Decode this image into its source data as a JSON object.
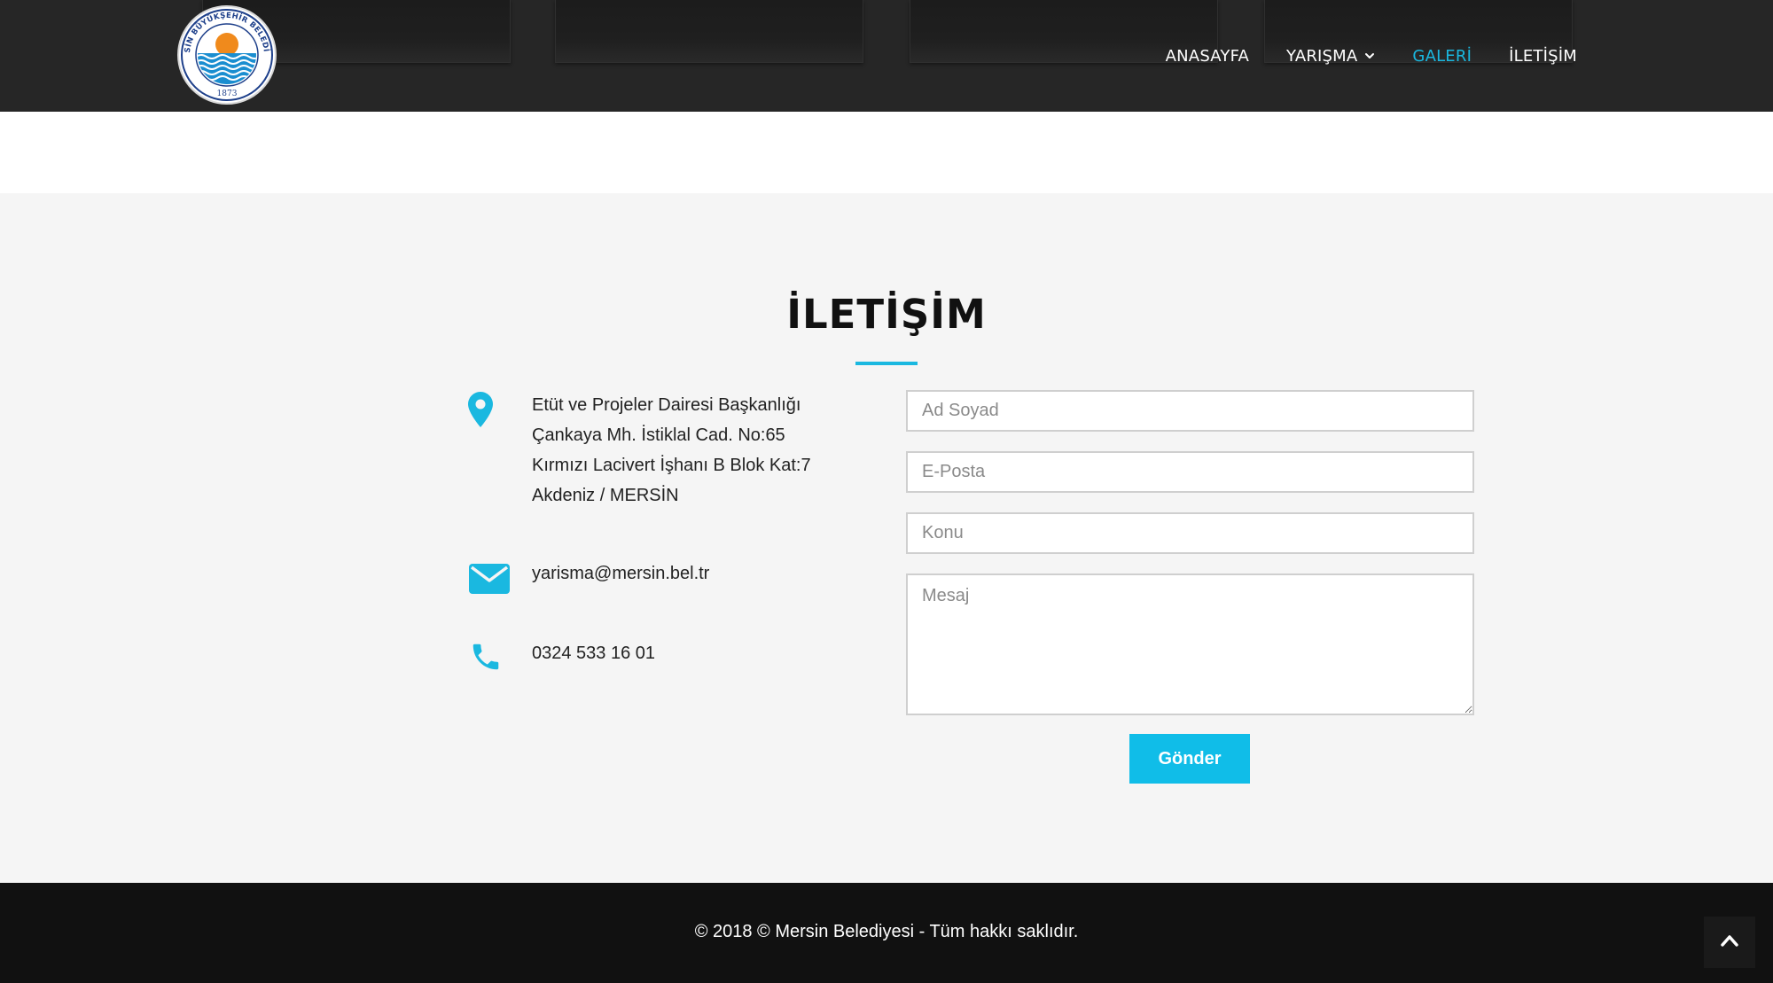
{
  "header": {
    "logo": {
      "ring_text": "MERSİN BÜYÜKŞEHİR BELEDİYESİ",
      "year": "1873"
    },
    "nav": [
      {
        "label": "ANASAYFA"
      },
      {
        "label": "YARIŞMA",
        "icon": "chevron-down-icon"
      },
      {
        "label": "GALERİ",
        "active": true
      },
      {
        "label": "İLETİŞİM"
      }
    ]
  },
  "contact": {
    "title": "İLETİŞİM",
    "address_lines": [
      "Etüt ve Projeler Dairesi Başkanlığı",
      "Çankaya Mh. İstiklal Cad. No:65",
      "Kırmızı Lacivert İşhanı B Blok Kat:7",
      "Akdeniz / MERSİN"
    ],
    "email": "yarisma@mersin.bel.tr",
    "phone": "0324 533 16 01",
    "form": {
      "name_placeholder": "Ad Soyad",
      "email_placeholder": "E-Posta",
      "subject_placeholder": "Konu",
      "message_placeholder": "Mesaj",
      "submit_label": "Gönder"
    }
  },
  "footer": {
    "copyright": "© 2018 © Mersin Belediyesi - Tüm hakkı saklıdır."
  },
  "colors": {
    "accent": "#1ab8e0",
    "header_bg": "#262626",
    "section_bg": "#f5f5f5",
    "footer_bg": "#111111"
  }
}
